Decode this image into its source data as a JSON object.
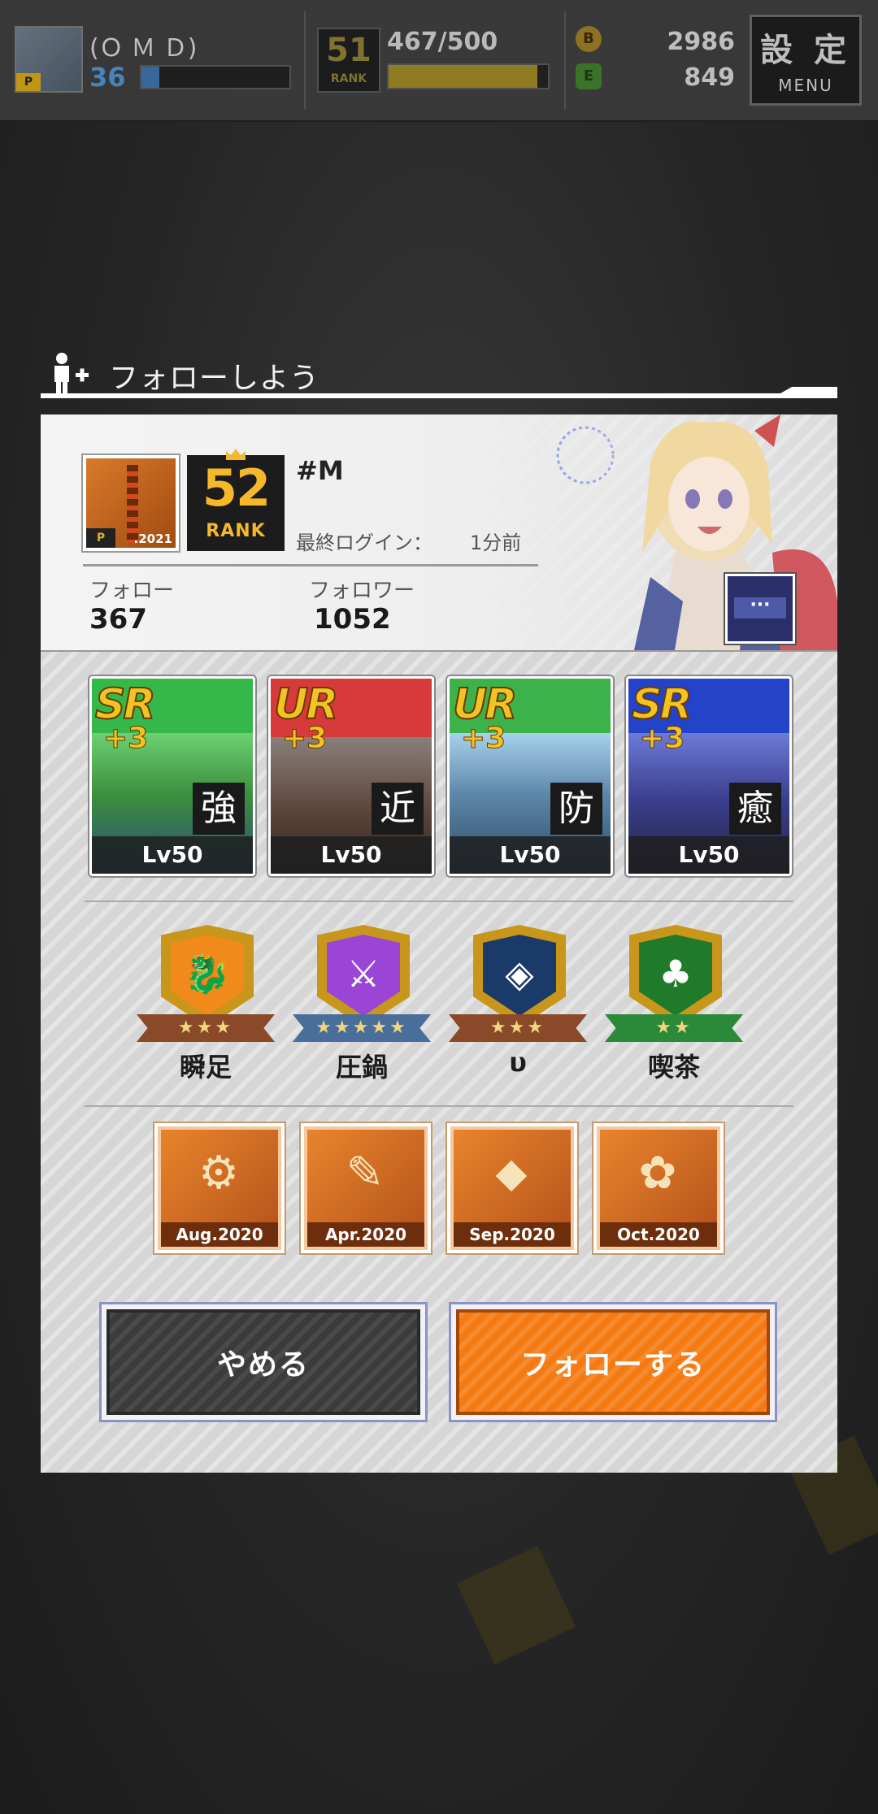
{
  "topbar": {
    "player_name": "(Ｏ Ｍ Ｄ)",
    "level": "36",
    "rank_number": "51",
    "rank_label": "RANK",
    "exp": "467/500",
    "exp_progress": 0.934,
    "gold_coins": "2986",
    "green_currency": "849",
    "menu_label_big": "設 定",
    "menu_label_small": "MENU",
    "avatar_badge": "P"
  },
  "dialog": {
    "title": "フォローしよう",
    "profile": {
      "avatar_badge": "P",
      "avatar_year": ".2021",
      "rank_number": "52",
      "rank_label": "RANK",
      "player_name": "#M",
      "last_login_label": "最終ログイン：",
      "last_login_value": "1分前",
      "follow_label": "フォロー",
      "follow_count": "367",
      "follower_label": "フォロワー",
      "follower_count": "1052",
      "more_icon": "···"
    },
    "cards": [
      {
        "rarity": "SR",
        "plus": "+3",
        "role": "強",
        "level": "Lv50"
      },
      {
        "rarity": "UR",
        "plus": "+3",
        "role": "近",
        "level": "Lv50"
      },
      {
        "rarity": "UR",
        "plus": "+3",
        "role": "防",
        "level": "Lv50"
      },
      {
        "rarity": "SR",
        "plus": "+3",
        "role": "癒",
        "level": "Lv50"
      }
    ],
    "badges": [
      {
        "label": "瞬足",
        "stars": "★★★",
        "color": "#f08a1a",
        "ribbon": "#8a4a2a"
      },
      {
        "label": "圧鍋",
        "stars": "★★★★★",
        "color": "#9a45d6",
        "ribbon": "#4a6e9a"
      },
      {
        "label": "υ",
        "stars": "★★★",
        "color": "#1a3a6a",
        "ribbon": "#8a4a2a"
      },
      {
        "label": "喫茶",
        "stars": "★★",
        "color": "#1f7a2a",
        "ribbon": "#2a8a3a"
      }
    ],
    "medals": [
      {
        "date": "Aug.2020",
        "icon": "spool-icon"
      },
      {
        "date": "Apr.2020",
        "icon": "document-pen-icon"
      },
      {
        "date": "Sep.2020",
        "icon": "coffin-icon"
      },
      {
        "date": "Oct.2020",
        "icon": "cotton-flower-icon"
      }
    ],
    "cancel_label": "やめる",
    "follow_button_label": "フォローする"
  }
}
